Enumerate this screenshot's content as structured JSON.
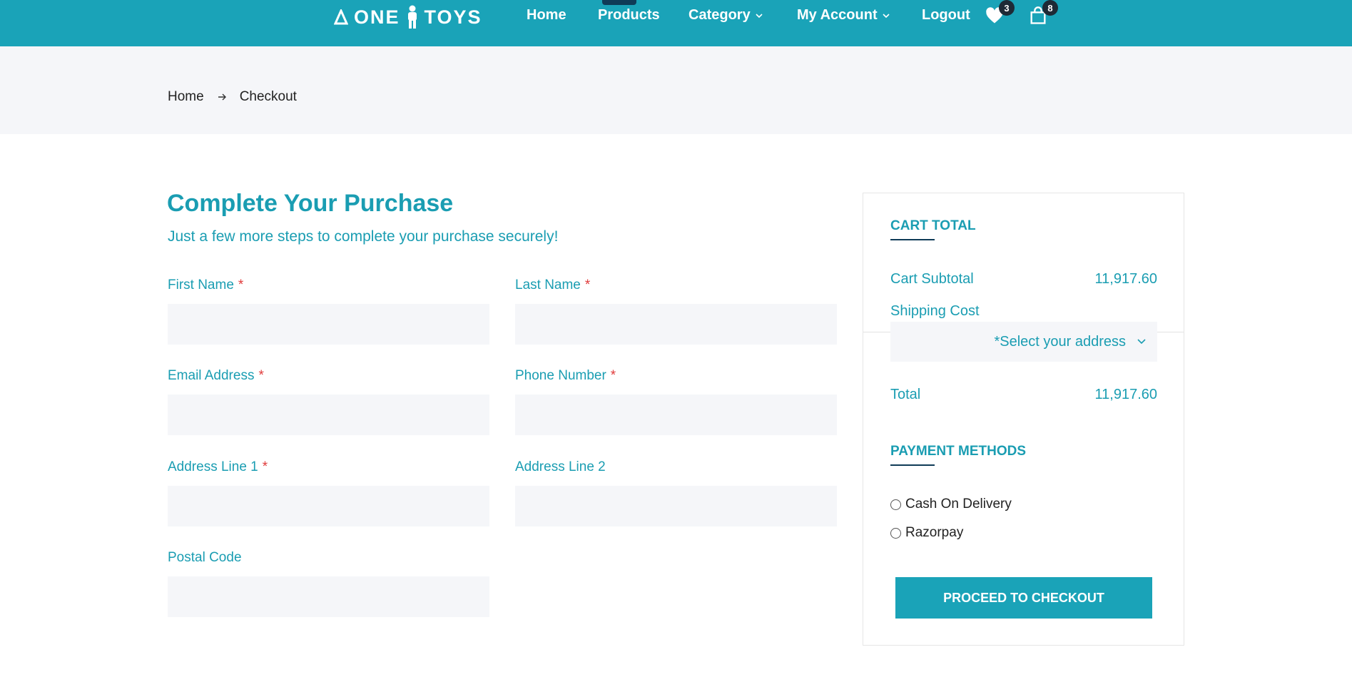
{
  "header": {
    "logo_text_left": "ONE",
    "logo_text_right": "TOYS",
    "nav": {
      "home": "Home",
      "products": "Products",
      "category": "Category",
      "my_account": "My Account",
      "logout": "Logout"
    },
    "wishlist_count": "3",
    "cart_count": "8"
  },
  "breadcrumb": {
    "home": "Home",
    "current": "Checkout"
  },
  "form": {
    "title": "Complete Your Purchase",
    "subtitle": "Just a few more steps to complete your purchase securely!",
    "required_mark": "*",
    "first_name_label": "First Name",
    "last_name_label": "Last Name",
    "email_label": "Email Address",
    "phone_label": "Phone Number",
    "address1_label": "Address Line 1",
    "address2_label": "Address Line 2",
    "postal_label": "Postal Code",
    "first_name_value": "",
    "last_name_value": "",
    "email_value": "",
    "phone_value": "",
    "address1_value": "",
    "address2_value": "",
    "postal_value": ""
  },
  "cart": {
    "title": "CART TOTAL",
    "subtotal_label": "Cart Subtotal",
    "subtotal_value": "11,917.60",
    "shipping_label": "Shipping Cost",
    "address_select": "*Select your address",
    "total_label": "Total",
    "total_value": "11,917.60",
    "payment_title": "PAYMENT METHODS",
    "payment_options": [
      "Cash On Delivery",
      "Razorpay"
    ],
    "checkout_button": "PROCEED TO CHECKOUT"
  },
  "colors": {
    "brand": "#1aa3b8",
    "dark": "#0f3b57",
    "required": "#e03a3a",
    "input_bg": "#f5f6f9"
  }
}
